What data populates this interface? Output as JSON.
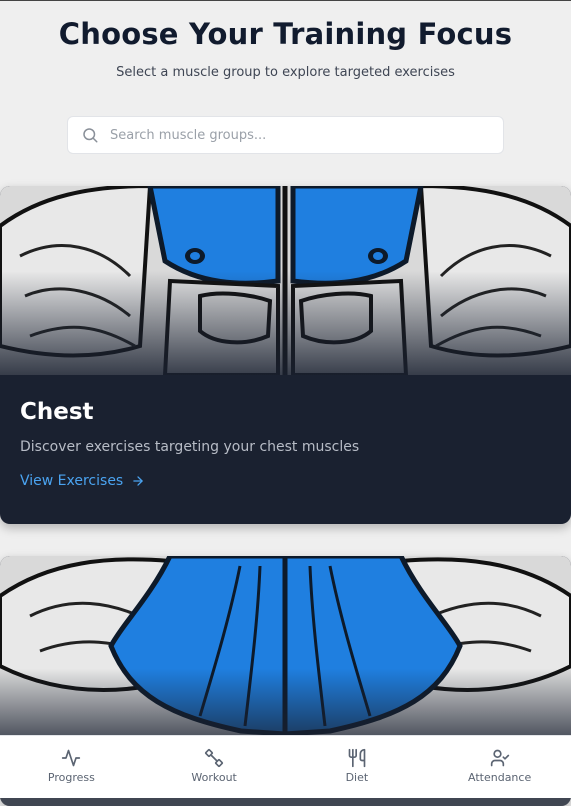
{
  "header": {
    "title": "Choose Your Training Focus",
    "subtitle": "Select a muscle group to explore targeted exercises"
  },
  "search": {
    "placeholder": "Search muscle groups...",
    "icon": "search-icon"
  },
  "cards": [
    {
      "title": "Chest",
      "description": "Discover exercises targeting your chest muscles",
      "link_label": "View Exercises",
      "link_icon": "arrow-right-icon"
    },
    {
      "title": "",
      "description": "",
      "link_label": ""
    }
  ],
  "bottom_nav": {
    "items": [
      {
        "label": "Progress",
        "icon": "activity-icon"
      },
      {
        "label": "Workout",
        "icon": "dumbbell-icon"
      },
      {
        "label": "Diet",
        "icon": "utensils-icon"
      },
      {
        "label": "Attendance",
        "icon": "user-check-icon"
      }
    ]
  },
  "colors": {
    "background": "#efefef",
    "card_dark": "#1a2130",
    "accent_blue": "#1f7fe0",
    "link_blue": "#4aa3f0"
  }
}
